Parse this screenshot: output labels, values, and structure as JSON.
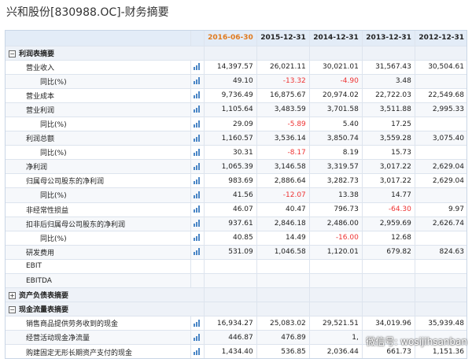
{
  "title": "兴和股份[830988.OC]-财务摘要",
  "watermark": "微信号: wosijihsanban",
  "colors": {
    "active_header": "#e07a1e",
    "negative": "#ee3333",
    "header_bg": "#e3ecf7"
  },
  "columns": [
    "2016-06-30",
    "2015-12-31",
    "2014-12-31",
    "2013-12-31",
    "2012-12-31"
  ],
  "rows": [
    {
      "type": "section",
      "label": "利润表摘要",
      "toggle": "⊟"
    },
    {
      "type": "row",
      "label": "营业收入",
      "indent": false,
      "chart": true,
      "values": [
        "14,397.57",
        "26,021.11",
        "30,021.01",
        "31,567.43",
        "30,504.61"
      ]
    },
    {
      "type": "row",
      "label": "同比(%)",
      "indent": true,
      "chart": true,
      "values": [
        "49.10",
        "-13.32",
        "-4.90",
        "3.48",
        ""
      ]
    },
    {
      "type": "row",
      "label": "营业成本",
      "indent": false,
      "chart": true,
      "values": [
        "9,736.49",
        "16,875.67",
        "20,974.02",
        "22,722.03",
        "22,549.68"
      ]
    },
    {
      "type": "row",
      "label": "营业利润",
      "indent": false,
      "chart": true,
      "values": [
        "1,105.64",
        "3,483.59",
        "3,701.58",
        "3,511.88",
        "2,995.33"
      ]
    },
    {
      "type": "row",
      "label": "同比(%)",
      "indent": true,
      "chart": true,
      "values": [
        "29.09",
        "-5.89",
        "5.40",
        "17.25",
        ""
      ]
    },
    {
      "type": "row",
      "label": "利润总额",
      "indent": false,
      "chart": true,
      "values": [
        "1,160.57",
        "3,536.14",
        "3,850.74",
        "3,559.28",
        "3,075.40"
      ]
    },
    {
      "type": "row",
      "label": "同比(%)",
      "indent": true,
      "chart": true,
      "values": [
        "30.31",
        "-8.17",
        "8.19",
        "15.73",
        ""
      ]
    },
    {
      "type": "row",
      "label": "净利润",
      "indent": false,
      "chart": true,
      "values": [
        "1,065.39",
        "3,146.58",
        "3,319.57",
        "3,017.22",
        "2,629.04"
      ]
    },
    {
      "type": "row",
      "label": "归属母公司股东的净利润",
      "indent": false,
      "chart": true,
      "values": [
        "983.69",
        "2,886.64",
        "3,282.73",
        "3,017.22",
        "2,629.04"
      ]
    },
    {
      "type": "row",
      "label": "同比(%)",
      "indent": true,
      "chart": true,
      "values": [
        "41.56",
        "-12.07",
        "13.38",
        "14.77",
        ""
      ]
    },
    {
      "type": "row",
      "label": "非经常性损益",
      "indent": false,
      "chart": true,
      "values": [
        "46.07",
        "40.47",
        "796.73",
        "-64.30",
        "9.97"
      ]
    },
    {
      "type": "row",
      "label": "扣非后归属母公司股东的净利润",
      "indent": false,
      "chart": true,
      "values": [
        "937.61",
        "2,846.18",
        "2,486.00",
        "2,959.69",
        "2,626.74"
      ]
    },
    {
      "type": "row",
      "label": "同比(%)",
      "indent": true,
      "chart": true,
      "values": [
        "40.85",
        "14.49",
        "-16.00",
        "12.68",
        ""
      ]
    },
    {
      "type": "row",
      "label": "研发费用",
      "indent": false,
      "chart": true,
      "values": [
        "531.09",
        "1,046.58",
        "1,120.01",
        "679.82",
        "824.63"
      ]
    },
    {
      "type": "row",
      "label": "EBIT",
      "indent": false,
      "chart": false,
      "values": [
        "",
        "",
        "",
        "",
        ""
      ]
    },
    {
      "type": "row",
      "label": "EBITDA",
      "indent": false,
      "chart": false,
      "values": [
        "",
        "",
        "",
        "",
        ""
      ]
    },
    {
      "type": "section",
      "label": "资产负债表摘要",
      "toggle": "⊞"
    },
    {
      "type": "section",
      "label": "现金流量表摘要",
      "toggle": "⊟"
    },
    {
      "type": "row",
      "label": "销售商品提供劳务收到的现金",
      "indent": false,
      "chart": true,
      "values": [
        "16,934.27",
        "25,083.02",
        "29,521.51",
        "34,019.96",
        "35,939.48"
      ]
    },
    {
      "type": "row",
      "label": "经营活动现金净流量",
      "indent": false,
      "chart": true,
      "values": [
        "446.87",
        "476.89",
        "1,",
        "",
        ""
      ]
    },
    {
      "type": "row",
      "label": "购建固定无形长期资产支付的现金",
      "indent": false,
      "chart": true,
      "values": [
        "1,434.40",
        "536.85",
        "2,036.44",
        "661.73",
        "1,151.36"
      ]
    }
  ]
}
